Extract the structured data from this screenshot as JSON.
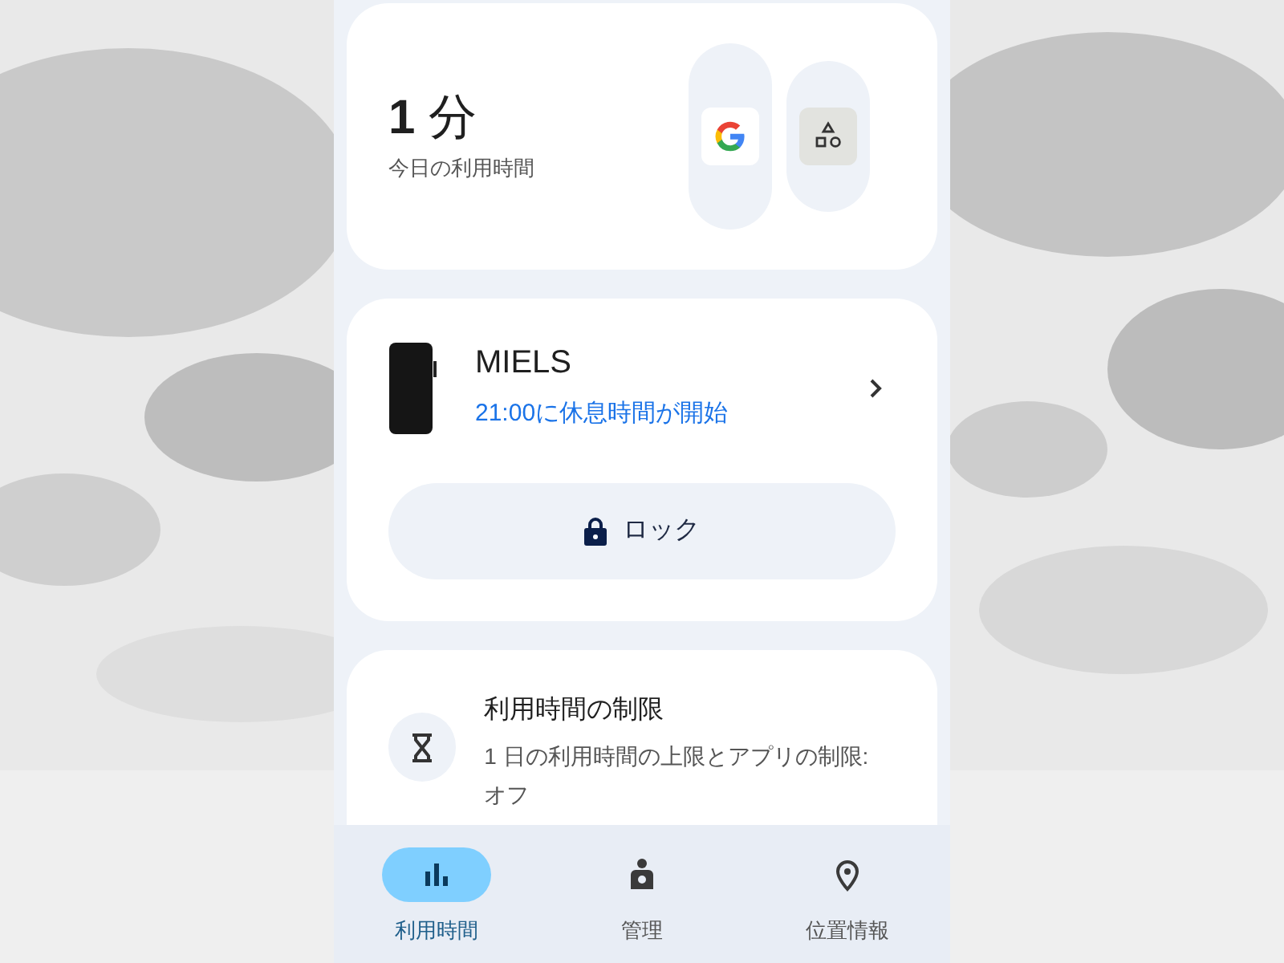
{
  "summary": {
    "total": "**1** 分",
    "caption": "今日の利用時間",
    "apps": [
      {
        "kind": "google"
      },
      {
        "kind": "generic"
      }
    ]
  },
  "device": {
    "name": "MIELS",
    "status": "21:00に休息時間が開始",
    "lock_button": "ロック"
  },
  "limits": {
    "title": "利用時間の制限",
    "description": "1 日の利用時間の上限とアプリの制限: オフ"
  },
  "nav": [
    {
      "label": "利用時間",
      "kind": "chart",
      "selected": true
    },
    {
      "label": "管理",
      "kind": "person",
      "selected": false
    },
    {
      "label": "位置情報",
      "kind": "pin",
      "selected": false
    }
  ]
}
